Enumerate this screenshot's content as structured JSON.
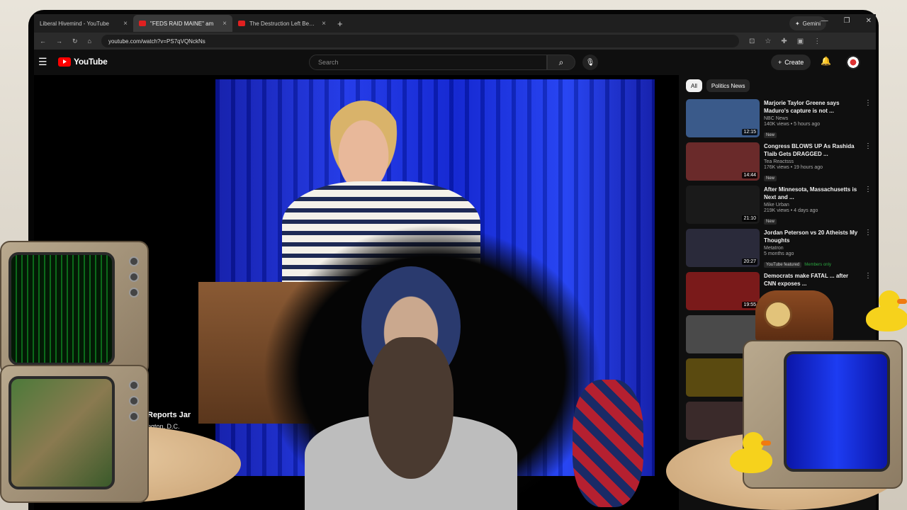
{
  "browser": {
    "tabs": [
      {
        "title": "Liberal Hivemind - YouTube",
        "active": false
      },
      {
        "title": "\"FEDS RAID MAINE\" am",
        "active": true
      },
      {
        "title": "The Destruction Left Behind Af",
        "active": false
      }
    ],
    "new_tab": "+",
    "gemini_label": "Gemini",
    "url": "youtube.com/watch?v=PS7qVQNckNs"
  },
  "youtube": {
    "logo_text": "YouTube",
    "search_placeholder": "Search",
    "create_label": "Create"
  },
  "video": {
    "chyron_title": "Reports Jar",
    "chyron_sub": "ngton, D.C."
  },
  "sidebar": {
    "chips": [
      {
        "label": "All",
        "selected": true
      },
      {
        "label": "Politics News",
        "selected": false
      }
    ],
    "items": [
      {
        "title": "Marjorie Taylor Greene says Maduro's capture is not ...",
        "channel": "NBC News",
        "views": "140K views • 5 hours ago",
        "badge": "New",
        "duration": "12:15",
        "thumb_color": "#3a5a8a"
      },
      {
        "title": "Congress BLOWS UP As Rashida Tlaib Gets DRAGGED ...",
        "channel": "Tea Reactsss",
        "views": "176K views • 19 hours ago",
        "badge": "New",
        "duration": "14:44",
        "thumb_color": "#6a2a2a"
      },
      {
        "title": "After Minnesota, Massachusetts is Next and ...",
        "channel": "Mike Urban",
        "views": "219K views • 4 days ago",
        "badge": "New",
        "duration": "21:10",
        "thumb_color": "#1a1a1a"
      },
      {
        "title": "Jordan Peterson vs 20 Atheists My Thoughts",
        "channel": "Metatron",
        "views": "5 months ago",
        "badge": "YouTube featured",
        "member": "Members only",
        "duration": "20:27",
        "thumb_color": "#2a2a3a"
      },
      {
        "title": "Democrats make FATAL ... after CNN exposes ...",
        "channel": "",
        "views": "",
        "badge": "",
        "duration": "19:55",
        "thumb_color": "#7a1a1a"
      }
    ]
  },
  "colors": {
    "yt_bg": "#0f0f0f",
    "yt_red": "#ff0000",
    "stage_blue": "#1a33e8"
  }
}
